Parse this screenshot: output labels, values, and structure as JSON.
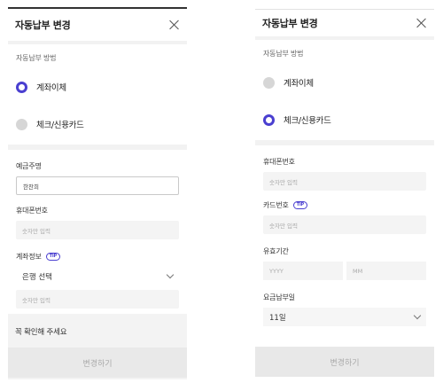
{
  "left": {
    "title": "자동납부 변경",
    "section_label": "자동납부 방법",
    "option_transfer": "계좌이체",
    "option_card": "체크/신용카드",
    "holder_label": "예금주명",
    "holder_value": "한찬희",
    "phone_label": "휴대폰번호",
    "phone_placeholder": "숫자만 입력",
    "account_label": "계좌정보",
    "tip": "TIP",
    "bank_select": "은행 선택",
    "account_placeholder": "숫자만 입력",
    "notice_title": "꼭 확인해 주세요",
    "submit": "변경하기"
  },
  "right": {
    "title": "자동납부 변경",
    "section_label": "자동납부 방법",
    "option_transfer": "계좌이체",
    "option_card": "체크/신용카드",
    "phone_label": "휴대폰번호",
    "phone_placeholder": "숫자만 입력",
    "card_label": "카드번호",
    "tip": "TIP",
    "card_placeholder": "숫자만 입력",
    "expiry_label": "유효기간",
    "expiry_year": "YYYY",
    "expiry_month": "MM",
    "billing_day_label": "요금납부일",
    "billing_day_value": "11일",
    "submit": "변경하기"
  },
  "colors": {
    "accent": "#4a3fd0",
    "disabled_button": "#e8e8e8"
  }
}
